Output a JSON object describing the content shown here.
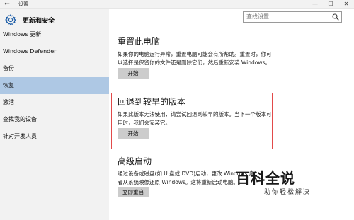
{
  "window": {
    "title": "设置",
    "back_icon": "arrow-left",
    "controls": {
      "minimize": "—",
      "maximize": "☐",
      "close": "✕"
    }
  },
  "sidebar": {
    "header_icon": "gear",
    "title": "更新和安全",
    "items": [
      {
        "label": "Windows 更新",
        "selected": false
      },
      {
        "label": "Windows Defender",
        "selected": false
      },
      {
        "label": "备份",
        "selected": false
      },
      {
        "label": "恢复",
        "selected": true
      },
      {
        "label": "激活",
        "selected": false
      },
      {
        "label": "查找我的设备",
        "selected": false
      },
      {
        "label": "针对开发人员",
        "selected": false
      }
    ]
  },
  "search": {
    "placeholder": "查找设置",
    "icon": "search"
  },
  "sections": {
    "reset": {
      "title": "重置此电脑",
      "desc_line1": "如果你的电脑运行异常，重置电脑可能会有所帮助。重置时，你可",
      "desc_line2": "以选择是保留你的文件还是删除它们，然后重新安装 Windows。",
      "button": "开始"
    },
    "rollback": {
      "title": "回退到较早的版本",
      "desc_line1": "如果此版本无法使用，请尝试回退到较早的版本。当下一个版本可",
      "desc_line2": "用时，我们会安装它。",
      "button": "开始"
    },
    "advanced": {
      "title": "高级启动",
      "desc_line1": "通过设备或磁盘(如 U 盘或 DVD)启动，更改 Windows 启",
      "desc_line2": "者从系统映像还原 Windows。这将重新启动电脑。",
      "button": "立即重启"
    }
  },
  "highlight_color": "#e24a4a",
  "accent_selected": "#aec8e4",
  "watermark": {
    "logo": "百科全说",
    "sub": "助你轻松解决"
  }
}
